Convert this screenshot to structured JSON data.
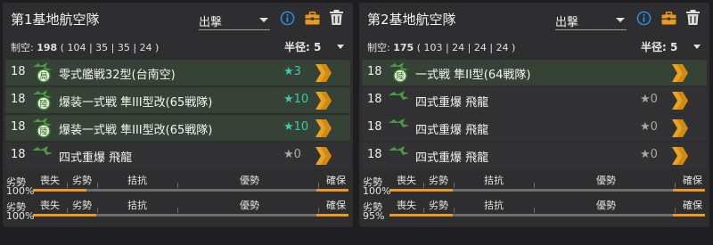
{
  "colors": {
    "accent_orange": "#e89a23",
    "info_blue": "#2a8fe0",
    "star_teal": "#3cc9ae",
    "slot_green": "#364236",
    "panel": "#2e2e31"
  },
  "air_labels": {
    "inferior": "劣勢",
    "loss": "喪失",
    "inferior2": "劣勢",
    "parity": "拮抗",
    "superiority": "優勢",
    "supremacy": "確保"
  },
  "panels": [
    {
      "title": "第1基地航空隊",
      "mode": "出撃",
      "icons": [
        "info-icon",
        "briefcase-icon",
        "trash-icon"
      ],
      "air_power_label": "制空:",
      "air_power": "198",
      "air_power_detail": "( 104 | 35 | 35 | 24 )",
      "radius_label": "半径:",
      "radius": "5",
      "slots": [
        {
          "count": "18",
          "name": "零式艦戦32型(台南空)",
          "star": "★3",
          "star_type": "teal",
          "badge": "局"
        },
        {
          "count": "18",
          "name": "爆装一式戦 隼III型改(65戦隊)",
          "star": "★10",
          "star_type": "teal",
          "badge": "陸"
        },
        {
          "count": "18",
          "name": "爆装一式戦 隼III型改(65戦隊)",
          "star": "★10",
          "star_type": "teal",
          "badge": "陸"
        },
        {
          "count": "18",
          "name": "四式重爆 飛龍",
          "star": "★0",
          "star_type": "gray",
          "badge": "陸"
        }
      ],
      "air_state_rows": [
        {
          "percent": "100%",
          "fill": 0.17
        },
        {
          "percent": "100%",
          "fill": 0.2
        }
      ]
    },
    {
      "title": "第2基地航空隊",
      "mode": "出撃",
      "icons": [
        "info-icon",
        "briefcase-icon",
        "trash-icon"
      ],
      "air_power_label": "制空:",
      "air_power": "175",
      "air_power_detail": "( 103 | 24 | 24 | 24 )",
      "radius_label": "半径:",
      "radius": "5",
      "slots": [
        {
          "count": "18",
          "name": "一式戦 隼II型(64戦隊)",
          "star": "",
          "star_type": "none",
          "badge": "陸"
        },
        {
          "count": "18",
          "name": "四式重爆 飛龍",
          "star": "★0",
          "star_type": "gray",
          "badge": "陸"
        },
        {
          "count": "18",
          "name": "四式重爆 飛龍",
          "star": "★0",
          "star_type": "gray",
          "badge": "陸"
        },
        {
          "count": "18",
          "name": "四式重爆 飛龍",
          "star": "★0",
          "star_type": "gray",
          "badge": "陸"
        }
      ],
      "air_state_rows": [
        {
          "percent": "100%",
          "fill": 0.2
        },
        {
          "percent": "95%",
          "fill": 0.2
        }
      ]
    }
  ]
}
